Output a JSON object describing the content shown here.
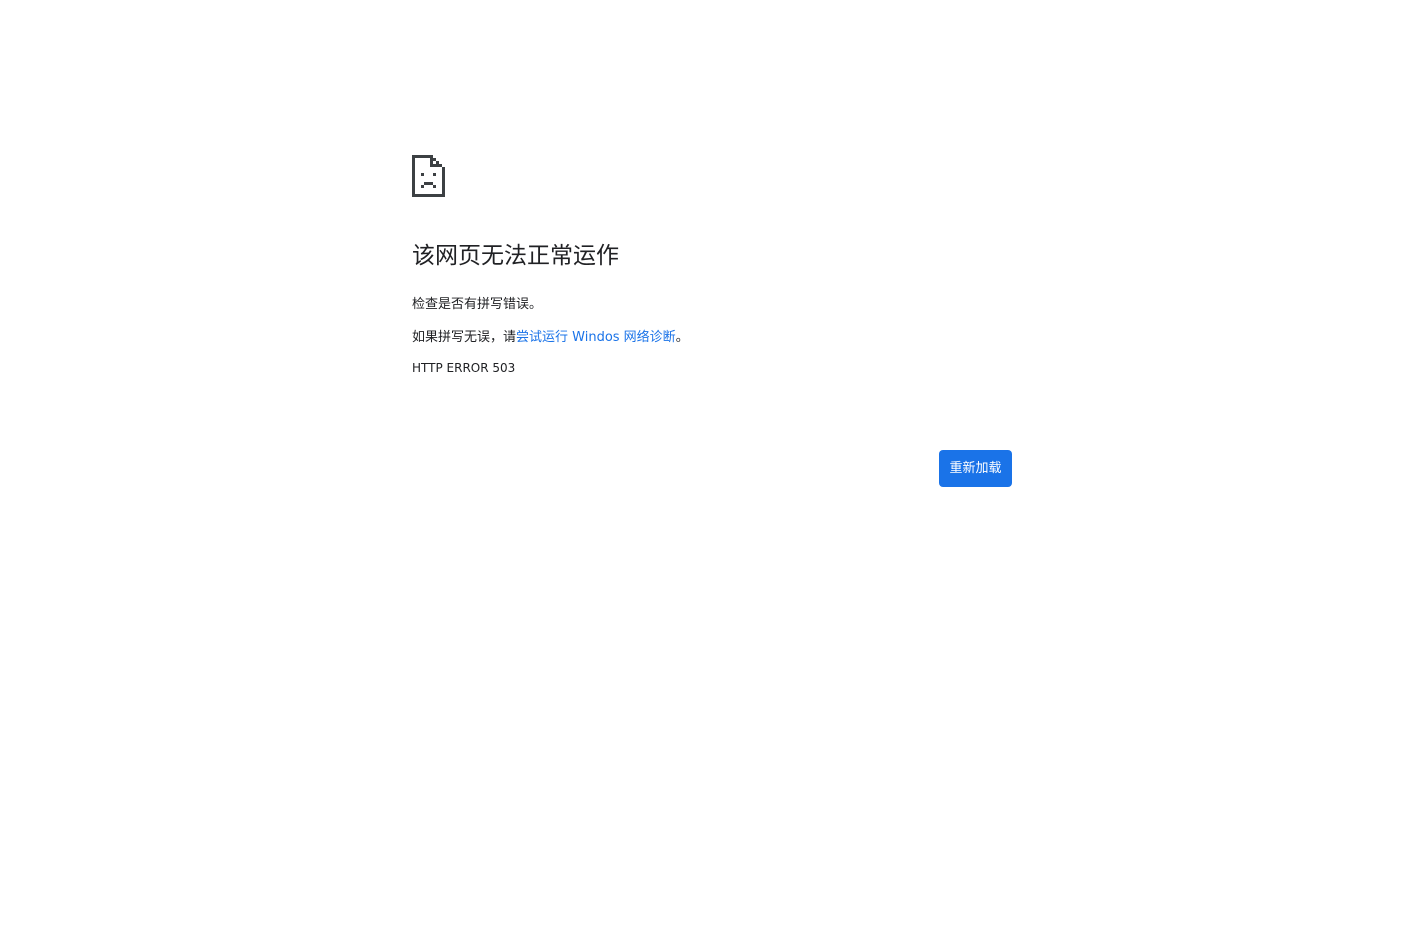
{
  "window": {
    "title": "该网页无法正常运作"
  },
  "error": {
    "icon": "sad-page-icon",
    "heading": "该网页无法正常运作",
    "check_spelling": "检查是否有拼写错误。",
    "suggestion_prefix": "如果拼写无误，请",
    "suggestion_link": "尝试运行 Windos 网络诊断",
    "suggestion_suffix": "。",
    "code": "HTTP ERROR 503"
  },
  "actions": {
    "reload_label": "重新加载"
  },
  "colors": {
    "accent": "#1a73e8",
    "text": "#202124",
    "icon": "#3c4043",
    "background": "#ffffff"
  }
}
